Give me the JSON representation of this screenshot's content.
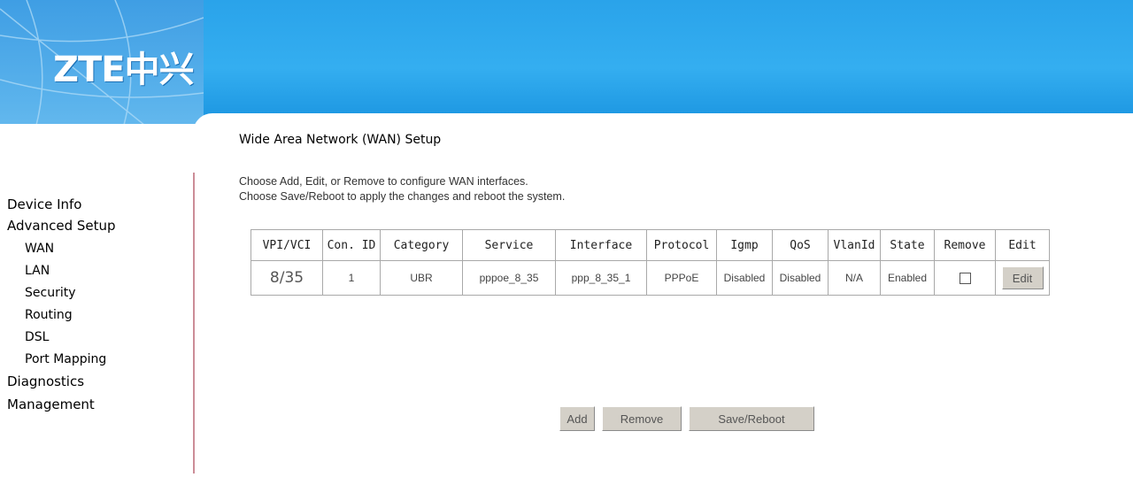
{
  "brand": {
    "logo_text": "ZTE中兴"
  },
  "nav": {
    "items": [
      {
        "label": "Device Info"
      },
      {
        "label": "Advanced Setup"
      },
      {
        "label": "WAN"
      },
      {
        "label": "LAN"
      },
      {
        "label": "Security"
      },
      {
        "label": "Routing"
      },
      {
        "label": "DSL"
      },
      {
        "label": "Port Mapping"
      },
      {
        "label": "Diagnostics"
      },
      {
        "label": "Management"
      }
    ]
  },
  "page": {
    "title": "Wide Area Network (WAN) Setup",
    "desc_line1": "Choose Add, Edit, or Remove to configure WAN interfaces.",
    "desc_line2": "Choose Save/Reboot to apply the changes and reboot the system."
  },
  "table": {
    "headers": [
      "VPI/VCI",
      "Con. ID",
      "Category",
      "Service",
      "Interface",
      "Protocol",
      "Igmp",
      "QoS",
      "VlanId",
      "State",
      "Remove",
      "Edit"
    ],
    "rows": [
      {
        "vpi_vci": "8/35",
        "con_id": "1",
        "category": "UBR",
        "service": "pppoe_8_35",
        "interface": "ppp_8_35_1",
        "protocol": "PPPoE",
        "igmp": "Disabled",
        "qos": "Disabled",
        "vlanid": "N/A",
        "state": "Enabled",
        "remove_checked": false,
        "edit_label": "Edit"
      }
    ]
  },
  "actions": {
    "add_label": "Add",
    "remove_label": "Remove",
    "save_reboot_label": "Save/Reboot"
  },
  "colors": {
    "header_blue": "#2aa3ea",
    "sidebar_border": "#cc8d97",
    "button_face": "#d4d0c8"
  }
}
